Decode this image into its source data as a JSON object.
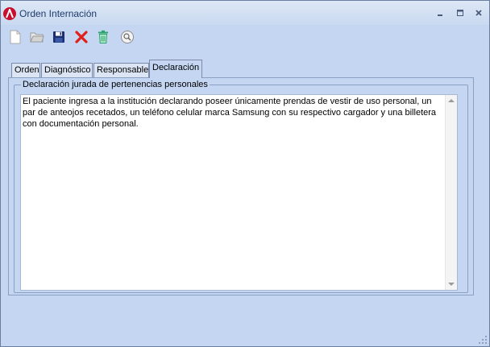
{
  "window": {
    "title": "Orden Internación",
    "controls": [
      "minimize",
      "maximize",
      "close"
    ]
  },
  "toolbar": {
    "buttons": [
      {
        "icon": "new-document-icon"
      },
      {
        "icon": "open-folder-icon"
      },
      {
        "icon": "save-icon"
      },
      {
        "icon": "delete-icon"
      },
      {
        "icon": "trash-icon"
      },
      {
        "icon": "search-icon"
      }
    ]
  },
  "tabs": [
    {
      "label": "Orden"
    },
    {
      "label": "Diagnóstico"
    },
    {
      "label": "Responsable"
    },
    {
      "label": "Declaración",
      "active": true
    }
  ],
  "declaracion": {
    "group_title": "Declaración jurada de pertenencias personales",
    "text": "El paciente ingresa a la institución declarando poseer únicamente prendas de vestir de uso personal, un par de anteojos recetados, un teléfono celular marca Samsung con su respectivo cargador y una billetera con documentación personal."
  },
  "colors": {
    "window_bg": "#c4d6f2",
    "title_text": "#1e3a6a",
    "app_icon": "#c8102e",
    "delete_icon": "#e0201a",
    "trash_icon": "#2aa36a"
  }
}
